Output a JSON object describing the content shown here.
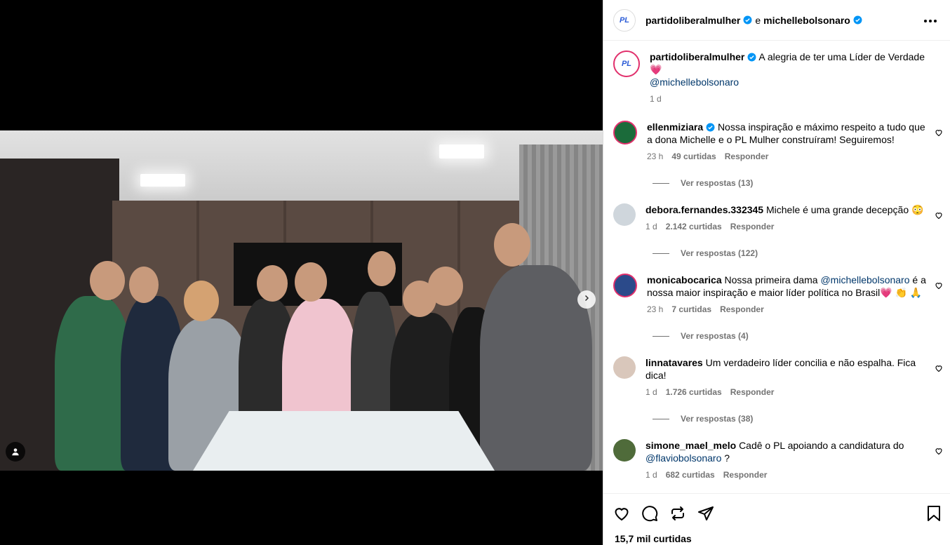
{
  "post": {
    "authors": [
      "partidoliberalmulher",
      "michellebolsonaro"
    ],
    "joiner": "e",
    "avatar_text": "PL",
    "caption_user": "partidoliberalmulher",
    "caption_text": "A alegria de ter uma Líder de Verdade 💗",
    "caption_mention": "@michellebolsonaro",
    "caption_time": "1 d",
    "likes": "15,7 mil curtidas"
  },
  "comments": [
    {
      "user": "ellenmiziara",
      "verified": true,
      "text": "Nossa inspiração e máximo respeito a tudo que a dona Michelle e o PL Mulher construíram! Seguiremos!",
      "time": "23 h",
      "likes": "49 curtidas",
      "reply": "Responder",
      "view_replies": "Ver respostas (13)"
    },
    {
      "user": "debora.fernandes.332345",
      "verified": false,
      "text": "Michele é uma grande decepção 😳",
      "time": "1 d",
      "likes": "2.142 curtidas",
      "reply": "Responder",
      "view_replies": "Ver respostas (122)"
    },
    {
      "user": "monicabocarica",
      "verified": false,
      "text_before": "Nossa primeira dama",
      "mention": "@michellebolsonaro",
      "text_after": "é a nossa maior inspiração e maior líder política no Brasil💗 👏 🙏",
      "time": "23 h",
      "likes": "7 curtidas",
      "reply": "Responder",
      "view_replies": "Ver respostas (4)"
    },
    {
      "user": "linnatavares",
      "verified": false,
      "text": "Um verdadeiro líder concilia e não espalha. Fica dica!",
      "time": "1 d",
      "likes": "1.726 curtidas",
      "reply": "Responder",
      "view_replies": "Ver respostas (38)"
    },
    {
      "user": "simone_mael_melo",
      "verified": false,
      "text_before": "Cadê o PL apoiando a candidatura do",
      "mention": "@flaviobolsonaro",
      "text_after": "?",
      "time": "1 d",
      "likes": "682 curtidas",
      "reply": "Responder"
    }
  ],
  "colors": {
    "verified": "#0095f6",
    "link": "#00376b",
    "muted": "#737373"
  },
  "icons": [
    "more-icon",
    "heart-icon",
    "comment-icon",
    "repost-icon",
    "share-icon",
    "save-icon",
    "chevron-right-icon",
    "user-tag-icon"
  ]
}
